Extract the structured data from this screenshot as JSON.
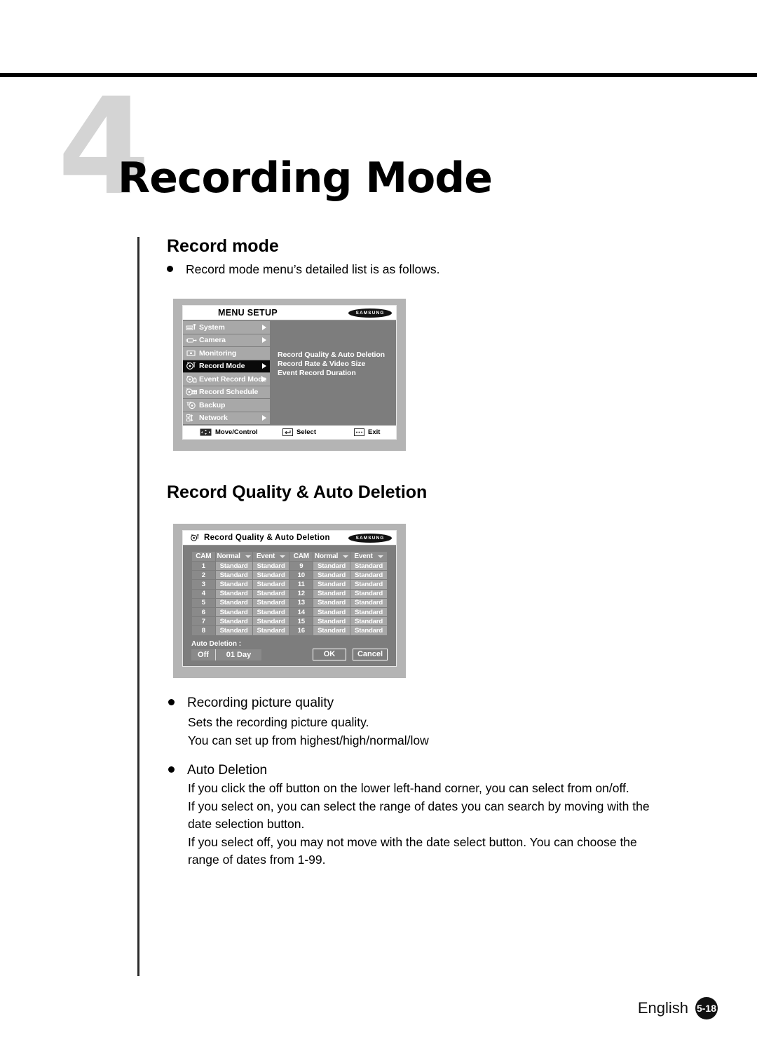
{
  "page": {
    "chapter_number": "4",
    "chapter_title": "Recording Mode",
    "footer_language": "English",
    "footer_page": "5-18"
  },
  "sections": {
    "record_mode": {
      "heading": "Record mode",
      "bullet": "Record mode menu’s detailed list is as follows."
    },
    "record_quality": {
      "heading": "Record Quality & Auto Deletion"
    }
  },
  "menu_setup_screenshot": {
    "title": "MENU SETUP",
    "brand": "SAMSUNG",
    "items": [
      {
        "label": "System",
        "icon": "system-icon",
        "arrow": true,
        "active": false
      },
      {
        "label": "Camera",
        "icon": "camera-icon",
        "arrow": true,
        "active": false
      },
      {
        "label": "Monitoring",
        "icon": "monitor-icon",
        "arrow": false,
        "active": false
      },
      {
        "label": "Record Mode",
        "icon": "record-mode-icon",
        "arrow": true,
        "active": true
      },
      {
        "label": "Event Record Mode",
        "icon": "event-record-icon",
        "arrow": true,
        "active": false
      },
      {
        "label": "Record Schedule",
        "icon": "record-schedule-icon",
        "arrow": false,
        "active": false
      },
      {
        "label": "Backup",
        "icon": "backup-icon",
        "arrow": false,
        "active": false
      },
      {
        "label": "Network",
        "icon": "network-icon",
        "arrow": true,
        "active": false
      }
    ],
    "submenu": [
      "Record Quality & Auto Deletion",
      "Record Rate & Video Size",
      "Event Record Duration"
    ],
    "footer": [
      {
        "label": "Move/Control",
        "icon": "dpad-icon"
      },
      {
        "label": "Select",
        "icon": "enter-key-icon"
      },
      {
        "label": "Exit",
        "icon": "menu-key-icon"
      }
    ]
  },
  "record_quality_screenshot": {
    "title": "Record Quality & Auto Deletion",
    "title_icon": "record-mode-icon",
    "brand": "SAMSUNG",
    "columns": [
      "CAM",
      "Normal",
      "Event",
      "CAM",
      "Normal",
      "Event"
    ],
    "rows": [
      [
        "1",
        "Standard",
        "Standard",
        "9",
        "Standard",
        "Standard"
      ],
      [
        "2",
        "Standard",
        "Standard",
        "10",
        "Standard",
        "Standard"
      ],
      [
        "3",
        "Standard",
        "Standard",
        "11",
        "Standard",
        "Standard"
      ],
      [
        "4",
        "Standard",
        "Standard",
        "12",
        "Standard",
        "Standard"
      ],
      [
        "5",
        "Standard",
        "Standard",
        "13",
        "Standard",
        "Standard"
      ],
      [
        "6",
        "Standard",
        "Standard",
        "14",
        "Standard",
        "Standard"
      ],
      [
        "7",
        "Standard",
        "Standard",
        "15",
        "Standard",
        "Standard"
      ],
      [
        "8",
        "Standard",
        "Standard",
        "16",
        "Standard",
        "Standard"
      ]
    ],
    "auto_deletion_label": "Auto Deletion :",
    "auto_deletion_state": "Off",
    "auto_deletion_days": "01  Day",
    "ok_label": "OK",
    "cancel_label": "Cancel"
  },
  "body": {
    "picture_quality": {
      "bullet": "Recording picture quality",
      "lines": [
        "Sets the recording picture quality.",
        "You can set up from highest/high/normal/low"
      ]
    },
    "auto_deletion": {
      "bullet": "Auto Deletion",
      "lines": [
        "If you click the off button on the lower left-hand corner, you can select from on/off.",
        "If you select on, you can select the range of dates you can search by moving with the",
        "date selection button.",
        "If you select off, you may not move with the date select button.  You can choose the",
        "range of dates from 1-99."
      ]
    }
  }
}
